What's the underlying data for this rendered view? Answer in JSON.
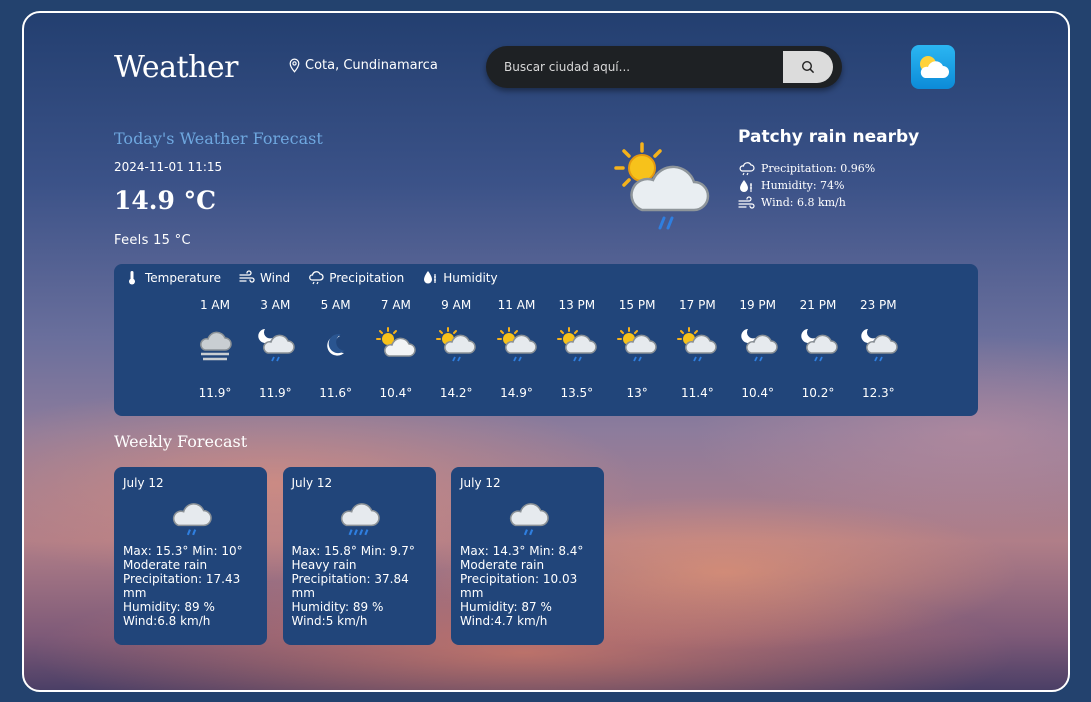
{
  "header": {
    "app_title": "Weather",
    "location": "Cota, Cundinamarca",
    "search_placeholder": "Buscar ciudad aquí...",
    "logo_icon": "partly-cloudy-logo-icon"
  },
  "current": {
    "heading": "Today's Weather Forecast",
    "datetime": "2024-11-01 11:15",
    "temperature": "14.9 °C",
    "feels_like": "Feels 15 °C",
    "condition": "Patchy rain nearby",
    "icon": "sun-cloud-rain-icon",
    "precipitation": "Precipitation: 0.96%",
    "humidity": "Humidity: 74%",
    "wind": "Wind: 6.8 km/h"
  },
  "tabs": [
    {
      "label": "Temperature",
      "icon": "thermometer-icon"
    },
    {
      "label": "Wind",
      "icon": "wind-icon"
    },
    {
      "label": "Precipitation",
      "icon": "cloud-rain-icon"
    },
    {
      "label": "Humidity",
      "icon": "humidity-icon"
    }
  ],
  "hourly": [
    {
      "time": "1 AM",
      "temp": "11.9°",
      "icon": "fog-icon"
    },
    {
      "time": "3 AM",
      "temp": "11.9°",
      "icon": "moon-cloud-rain-icon"
    },
    {
      "time": "5 AM",
      "temp": "11.6°",
      "icon": "moon-icon"
    },
    {
      "time": "7 AM",
      "temp": "10.4°",
      "icon": "sun-cloud-icon"
    },
    {
      "time": "9 AM",
      "temp": "14.2°",
      "icon": "sun-cloud-rain-icon"
    },
    {
      "time": "11 AM",
      "temp": "14.9°",
      "icon": "sun-cloud-rain-icon"
    },
    {
      "time": "13 PM",
      "temp": "13.5°",
      "icon": "sun-cloud-rain-icon"
    },
    {
      "time": "15 PM",
      "temp": "13°",
      "icon": "sun-cloud-rain-icon"
    },
    {
      "time": "17 PM",
      "temp": "11.4°",
      "icon": "sun-cloud-rain-icon"
    },
    {
      "time": "19 PM",
      "temp": "10.4°",
      "icon": "moon-cloud-rain-icon"
    },
    {
      "time": "21 PM",
      "temp": "10.2°",
      "icon": "moon-cloud-rain-icon"
    },
    {
      "time": "23 PM",
      "temp": "12.3°",
      "icon": "moon-cloud-rain-icon"
    }
  ],
  "weekly": {
    "heading": "Weekly Forecast",
    "days": [
      {
        "date": "July 12",
        "maxmin": "Max: 15.3° Min: 10°",
        "condition": "Moderate rain",
        "precipitation": "Precipitation: 17.43 mm",
        "humidity": "Humidity: 89 %",
        "wind": "Wind:6.8 km/h",
        "icon": "cloud-rain-icon"
      },
      {
        "date": "July 12",
        "maxmin": "Max: 15.8° Min: 9.7°",
        "condition": "Heavy rain",
        "precipitation": "Precipitation: 37.84 mm",
        "humidity": "Humidity: 89 %",
        "wind": "Wind:5 km/h",
        "icon": "cloud-heavy-rain-icon"
      },
      {
        "date": "July 12",
        "maxmin": "Max: 14.3° Min: 8.4°",
        "condition": "Moderate rain",
        "precipitation": "Precipitation: 10.03 mm",
        "humidity": "Humidity: 87 %",
        "wind": "Wind:4.7 km/h",
        "icon": "cloud-rain-icon"
      }
    ]
  },
  "colors": {
    "panel": "#21457a",
    "heading_blue": "#6ea7df",
    "rain": "#2f7fe0",
    "sun": "#f5b21b"
  }
}
